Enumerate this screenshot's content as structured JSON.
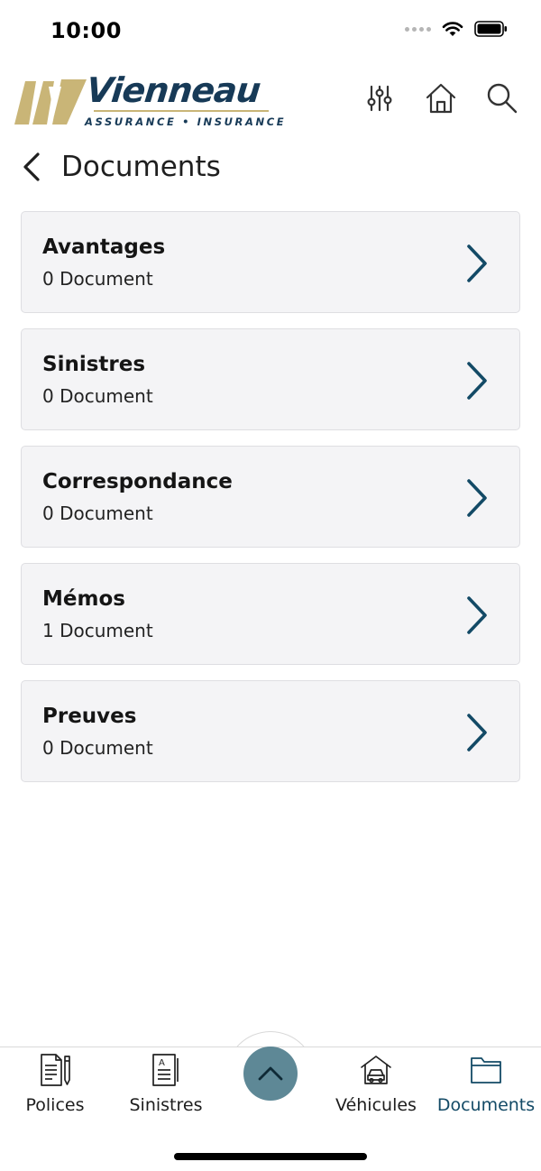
{
  "status_bar": {
    "time": "10:00"
  },
  "header": {
    "logo_name": "Vienneau",
    "logo_tagline": "ASSURANCE  •  INSURANCE",
    "actions": [
      {
        "icon": "filter-sliders-icon"
      },
      {
        "icon": "home-icon"
      },
      {
        "icon": "search-icon"
      }
    ]
  },
  "page": {
    "title": "Documents"
  },
  "documents": [
    {
      "title": "Avantages",
      "count": "0 Document"
    },
    {
      "title": "Sinistres",
      "count": "0 Document"
    },
    {
      "title": "Correspondance",
      "count": "0 Document"
    },
    {
      "title": "Mémos",
      "count": "1 Document"
    },
    {
      "title": "Preuves",
      "count": "0 Document"
    }
  ],
  "bottom_nav": {
    "items": [
      {
        "label": "Polices",
        "icon": "policy-document-icon"
      },
      {
        "label": "Sinistres",
        "icon": "claim-form-icon"
      },
      {
        "label": "Véhicules",
        "icon": "vehicle-garage-icon"
      },
      {
        "label": "Documents",
        "icon": "folder-icon",
        "active": true
      }
    ],
    "fab_icon": "chevron-up-icon"
  },
  "colors": {
    "brand_navy": "#173a57",
    "brand_gold": "#c9b577",
    "chevron": "#134a66",
    "fab": "#5e8896",
    "card_bg": "#f4f4f6",
    "active_nav": "#134a66"
  }
}
